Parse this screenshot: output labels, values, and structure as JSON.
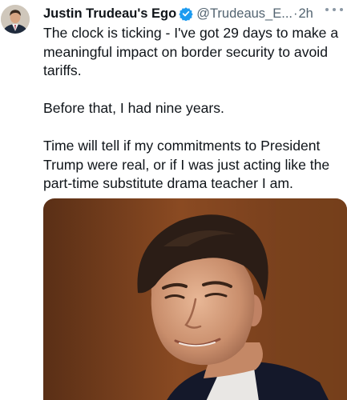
{
  "author": {
    "display_name": "Justin Trudeau's Ego",
    "handle": "@Trudeaus_E...",
    "separator": "·",
    "time": "2h",
    "avatar_icon": "profile-photo",
    "verified_icon": "verified-badge-icon",
    "verified_color": "#1d9bf0"
  },
  "tweet": {
    "paragraphs": [
      "The clock is ticking - I've got 29 days to make a meaningful impact on border security to avoid tariffs.",
      "Before that, I had nine years.",
      "Time will tell if my commitments to President Trump were real, or if I was just acting like the part-time substitute drama teacher I am."
    ]
  },
  "media": {
    "type": "photo"
  },
  "more_icon": "more-options-icon"
}
